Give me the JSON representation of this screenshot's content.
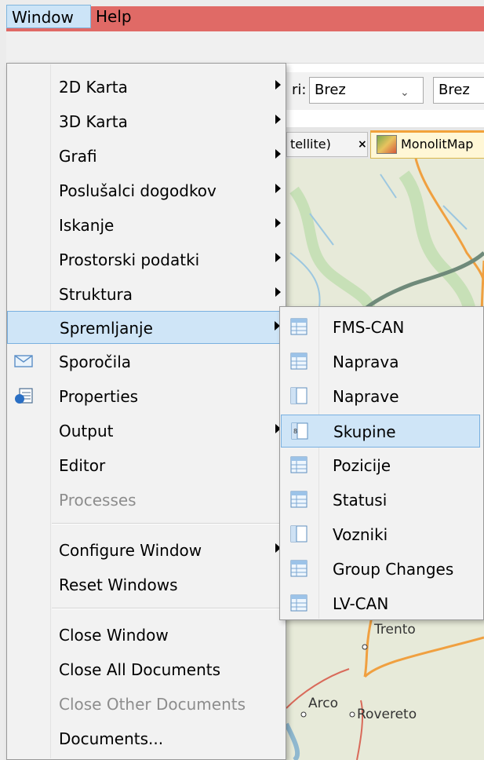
{
  "menubar": {
    "items": [
      {
        "label": "Window"
      },
      {
        "label": "Help"
      }
    ]
  },
  "toolbar": {
    "label": "ri:",
    "select1_value": "Brez",
    "select2_value": "Brez"
  },
  "tabs": [
    {
      "label": "tellite)",
      "close": "×"
    },
    {
      "label": "MonolitMap"
    }
  ],
  "map": {
    "places": [
      "Trento",
      "Arco",
      "Rovereto"
    ]
  },
  "window_menu": {
    "items": [
      {
        "label": "2D Karta",
        "submenu": true
      },
      {
        "label": "3D Karta",
        "submenu": true
      },
      {
        "label": "Grafi",
        "submenu": true
      },
      {
        "label": "Poslušalci dogodkov",
        "submenu": true
      },
      {
        "label": "Iskanje",
        "submenu": true
      },
      {
        "label": "Prostorski podatki",
        "submenu": true
      },
      {
        "label": "Struktura",
        "submenu": true
      },
      {
        "label": "Spremljanje",
        "submenu": true,
        "active": true
      },
      {
        "label": "Sporočila",
        "icon": "envelope-icon"
      },
      {
        "label": "Properties",
        "icon": "properties-icon"
      },
      {
        "label": "Output",
        "submenu": true
      },
      {
        "label": "Editor"
      },
      {
        "label": "Processes",
        "disabled": true
      },
      {
        "label": "Configure Window",
        "submenu": true
      },
      {
        "label": "Reset Windows"
      },
      {
        "label": "Close Window"
      },
      {
        "label": "Close All Documents"
      },
      {
        "label": "Close Other Documents",
        "disabled": true
      },
      {
        "label": "Documents..."
      }
    ]
  },
  "spremljanje_submenu": {
    "items": [
      {
        "label": "FMS-CAN",
        "icon": "table-icon"
      },
      {
        "label": "Naprava",
        "icon": "table-icon"
      },
      {
        "label": "Naprave",
        "icon": "list-table-icon"
      },
      {
        "label": "Skupine",
        "icon": "group-table-icon",
        "active": true
      },
      {
        "label": "Pozicije",
        "icon": "table-icon"
      },
      {
        "label": "Statusi",
        "icon": "table-icon"
      },
      {
        "label": "Vozniki",
        "icon": "list-table-icon"
      },
      {
        "label": "Group Changes",
        "icon": "table-icon"
      },
      {
        "label": "LV-CAN",
        "icon": "table-icon"
      }
    ]
  },
  "colors": {
    "titlebar": "#e06a66",
    "highlight_bg": "#cfe5f7",
    "highlight_border": "#79b0e0",
    "menu_bg": "#f2f2f2",
    "disabled_text": "#8d8d8d"
  }
}
